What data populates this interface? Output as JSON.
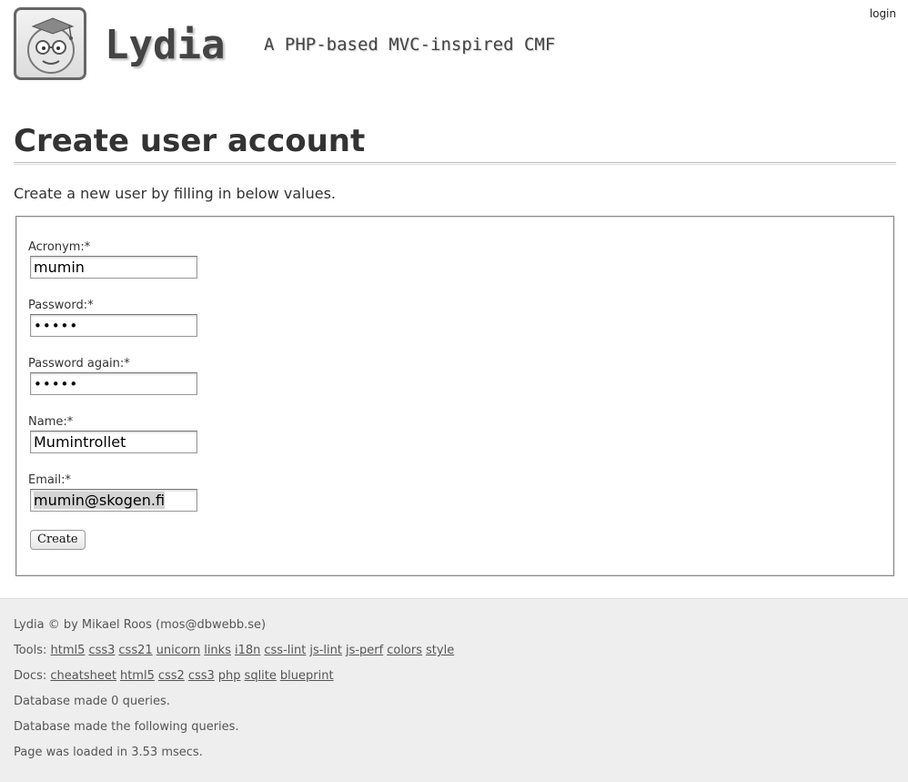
{
  "header": {
    "login_label": "login",
    "site_title": "Lydia",
    "site_slogan": "A PHP-based MVC-inspired CMF",
    "logo_icon": "lydia-logo-icon"
  },
  "main": {
    "page_title": "Create user account",
    "intro": "Create a new user by filling in below values.",
    "form": {
      "fields": [
        {
          "label": "Acronym:*",
          "value": "mumin",
          "type": "text"
        },
        {
          "label": "Password:*",
          "value": "•••••",
          "type": "password"
        },
        {
          "label": "Password again:*",
          "value": "•••••",
          "type": "password"
        },
        {
          "label": "Name:*",
          "value": "Mumintrollet",
          "type": "text"
        },
        {
          "label": "Email:*",
          "value": "mumin@skogen.fi",
          "type": "text"
        }
      ],
      "submit_label": "Create"
    }
  },
  "footer": {
    "copyright": "Lydia © by Mikael Roos (mos@dbwebb.se)",
    "tools_label": "Tools:",
    "tools_links": [
      "html5",
      "css3",
      "css21",
      "unicorn",
      "links",
      "i18n",
      "css-lint",
      "js-lint",
      "js-perf",
      "colors",
      "style"
    ],
    "docs_label": "Docs:",
    "docs_links": [
      "cheatsheet",
      "html5",
      "css2",
      "css3",
      "php",
      "sqlite",
      "blueprint"
    ],
    "db_queries": "Database made 0 queries.",
    "db_following": "Database made the following queries.",
    "load_time": "Page was loaded in 3.53 msecs."
  }
}
